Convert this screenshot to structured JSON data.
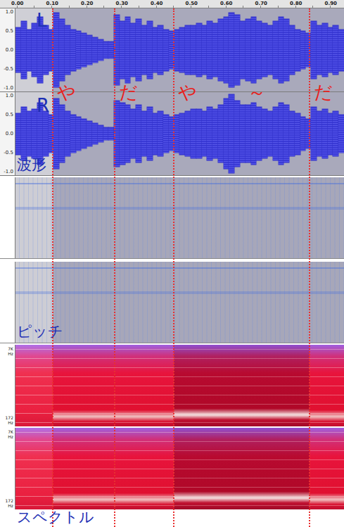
{
  "ruler": {
    "ticks": [
      "0.00",
      "0.10",
      "0.20",
      "0.30",
      "0.40",
      "0.50",
      "0.60",
      "0.70",
      "0.80",
      "0.90"
    ]
  },
  "selection": {
    "start": 0.103
  },
  "waveform": {
    "label": "波形",
    "channels": [
      {
        "name": "L",
        "axis": [
          "1.0",
          "0.5",
          "0.0",
          "-0.5",
          "-1.0"
        ],
        "envelope": [
          0.55,
          0.7,
          0.5,
          0.65,
          0.8,
          0.6,
          0.5,
          0.9,
          0.75,
          0.6,
          0.5,
          0.45,
          0.4,
          0.35,
          0.3,
          0.25,
          0.2,
          0.2,
          0.85,
          0.7,
          0.8,
          0.65,
          0.75,
          0.6,
          0.7,
          0.55,
          0.6,
          0.5,
          0.45,
          0.5,
          0.55,
          0.6,
          0.6,
          0.65,
          0.6,
          0.7,
          0.65,
          0.75,
          0.8,
          0.9,
          0.85,
          0.7,
          0.75,
          0.8,
          0.7,
          0.65,
          0.6,
          0.7,
          0.8,
          0.75,
          0.6,
          0.5,
          0.45,
          0.4,
          0.7,
          0.6,
          0.65,
          0.55,
          0.6,
          0.5
        ]
      },
      {
        "name": "R",
        "axis": [
          "1.0",
          "0.5",
          "0.0",
          "-0.5",
          "-1.0"
        ],
        "envelope": [
          0.5,
          0.65,
          0.55,
          0.6,
          0.75,
          0.55,
          0.45,
          0.85,
          0.7,
          0.55,
          0.45,
          0.4,
          0.35,
          0.3,
          0.25,
          0.2,
          0.15,
          0.15,
          0.8,
          0.75,
          0.7,
          0.6,
          0.7,
          0.55,
          0.65,
          0.5,
          0.55,
          0.45,
          0.4,
          0.45,
          0.5,
          0.55,
          0.6,
          0.6,
          0.55,
          0.65,
          0.6,
          0.7,
          0.85,
          0.95,
          0.8,
          0.7,
          0.7,
          0.75,
          0.65,
          0.6,
          0.55,
          0.65,
          0.75,
          0.7,
          0.55,
          0.5,
          0.4,
          0.35,
          0.65,
          0.55,
          0.6,
          0.5,
          0.55,
          0.45
        ]
      }
    ]
  },
  "pitch": {
    "label": "ピッチ"
  },
  "spectrum": {
    "label": "スペクトル",
    "top": "7K",
    "bottom": "172",
    "unit": "Hz"
  },
  "syllables": [
    {
      "text": "や",
      "time": 0.103,
      "marker": true,
      "loud": false
    },
    {
      "text": "だ",
      "time": 0.281,
      "marker": true,
      "loud": false
    },
    {
      "text": "や",
      "time": 0.45,
      "marker": true,
      "loud": true
    },
    {
      "text": "～",
      "time": 0.65,
      "marker": false,
      "loud": true
    },
    {
      "text": "だ",
      "time": 0.84,
      "marker": true,
      "loud": false
    }
  ]
}
